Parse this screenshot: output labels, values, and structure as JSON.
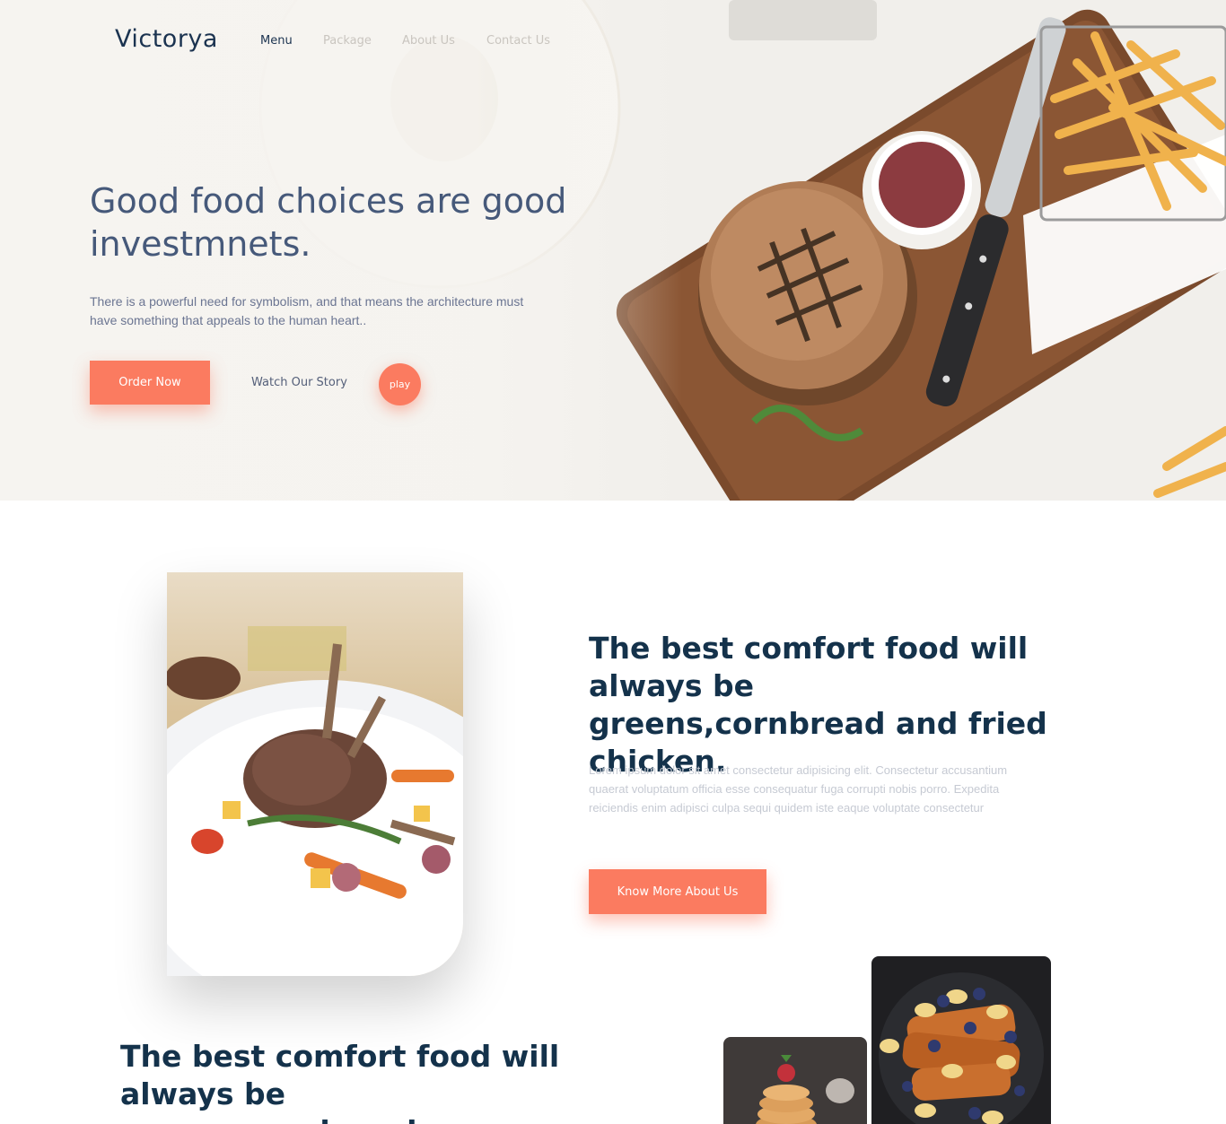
{
  "brand": "Victorya",
  "nav": [
    "Menu",
    "Package",
    "About Us",
    "Contact Us"
  ],
  "hero": {
    "title": "Good food choices are good investmnets.",
    "subtitle": "There is a powerful need for symbolism, and that means the architecture must have something that appeals to the human heart..",
    "order_label": "Order Now",
    "watch_label": "Watch Our Story",
    "play_label": "play"
  },
  "about": {
    "title": "The best comfort food will always be greens,cornbread and fried chicken.",
    "text": "Lorem ipsum dolor sit amet consectetur adipisicing elit. Consectetur accusantium quaerat voluptatum officia esse consequatur fuga corrupti nobis porro. Expedita reiciendis enim adipisci culpa sequi quidem iste eaque voluptate consectetur",
    "button_label": "Know More About Us"
  },
  "bottom": {
    "title": "The best comfort food will always be greens,cornbread"
  },
  "colors": {
    "accent": "#fb7b60",
    "heading": "#14324b",
    "hero_title": "#46597a"
  }
}
